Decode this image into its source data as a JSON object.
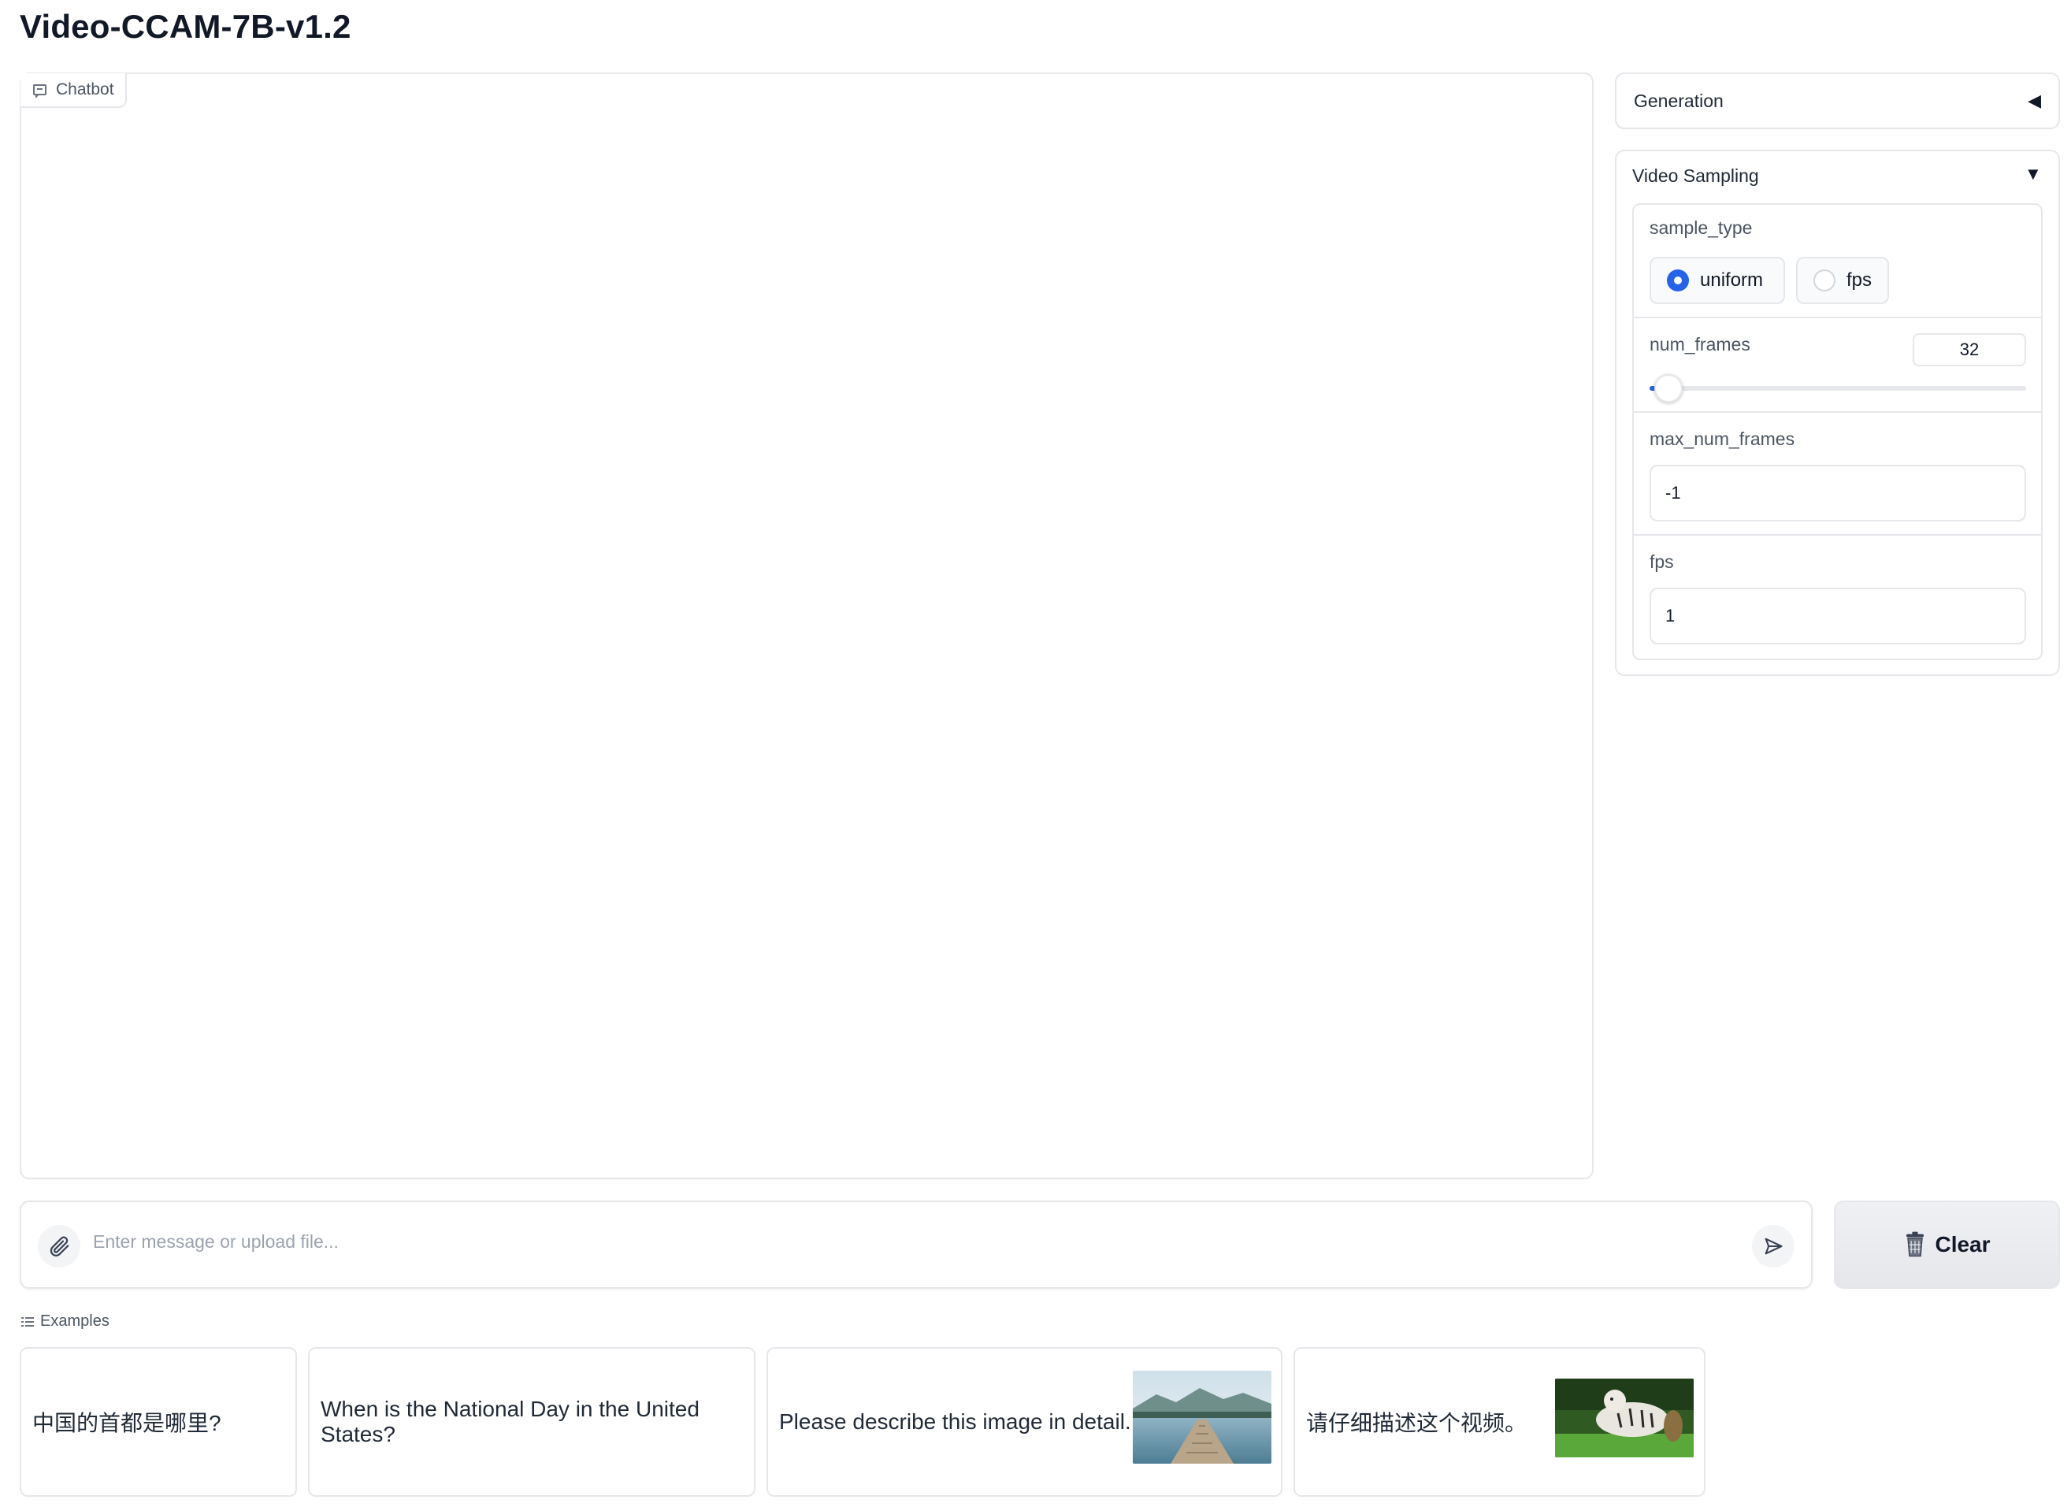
{
  "app_title": "Video-CCAM-7B-v1.2",
  "chatbot": {
    "label": "Chatbot"
  },
  "generation": {
    "title": "Generation",
    "toggle": "◀"
  },
  "video_sampling": {
    "title": "Video Sampling",
    "toggle": "▼",
    "sample_type": {
      "label": "sample_type",
      "options": [
        "uniform",
        "fps"
      ],
      "selected": "uniform"
    },
    "num_frames": {
      "label": "num_frames",
      "value": "32",
      "slider_fraction": 0.05
    },
    "max_num_frames": {
      "label": "max_num_frames",
      "value": "-1"
    },
    "fps": {
      "label": "fps",
      "value": "1"
    }
  },
  "input": {
    "placeholder": "Enter message or upload file..."
  },
  "clear_button": {
    "label": "Clear"
  },
  "examples": {
    "label": "Examples",
    "items": [
      {
        "text": "中国的首都是哪里?"
      },
      {
        "text": "When is the National Day in the United States?"
      },
      {
        "text": "Please describe this image in detail."
      },
      {
        "text": "请仔细描述这个视频。"
      }
    ]
  },
  "colors": {
    "accent": "#2563eb",
    "border": "#e5e7eb"
  }
}
